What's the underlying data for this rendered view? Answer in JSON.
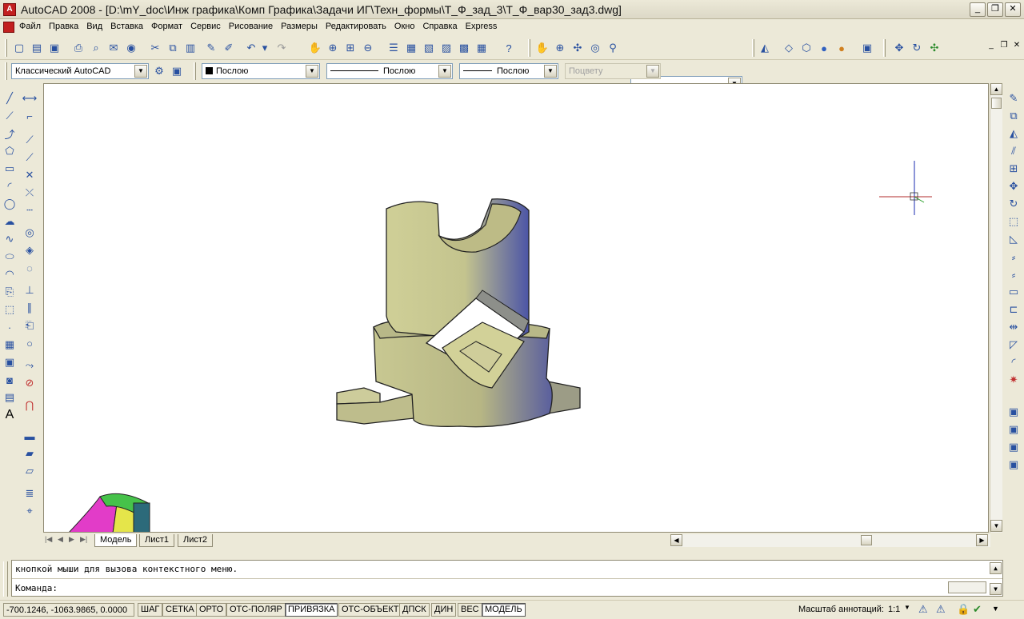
{
  "window": {
    "title": "AutoCAD 2008 - [D:\\mY_doc\\Инж графика\\Комп Графика\\Задачи ИГ\\Техн_формы\\Т_Ф_зад_3\\Т_Ф_вар30_зад3.dwg]",
    "minimize": "_",
    "restore": "❐",
    "close": "✕"
  },
  "menu": {
    "items": [
      "Файл",
      "Правка",
      "Вид",
      "Вставка",
      "Формат",
      "Сервис",
      "Рисование",
      "Размеры",
      "Редактировать",
      "Окно",
      "Справка",
      "Express"
    ]
  },
  "toolbar1": {
    "view_combo_value": ""
  },
  "toolbar2": {
    "workspace": "Классический AutoCAD",
    "layer": "Послою",
    "linetype": "Послою",
    "lineweight": "Послою",
    "plotstyle": "Поцвету"
  },
  "layout_tabs": {
    "tabs": [
      "Модель",
      "Лист1",
      "Лист2"
    ],
    "active": "Модель"
  },
  "command": {
    "history": "кнопкой мыши для вызова контекстного меню.",
    "prompt": "Команда:"
  },
  "status": {
    "coords": "-700.1246, -1063.9865, 0.0000",
    "buttons": [
      "ШАГ",
      "СЕТКА",
      "ОРТО",
      "ОТС-ПОЛЯР",
      "ПРИВЯЗКА",
      "ОТС-ОБЪЕКТ",
      "ДПСК",
      "ДИН",
      "ВЕС",
      "МОДЕЛЬ"
    ],
    "active_buttons": [
      "ПРИВЯЗКА",
      "МОДЕЛЬ"
    ],
    "annotation_label": "Масштаб аннотаций:",
    "annotation_scale": "1:1"
  },
  "colors": {
    "model_face": "#c9c98f",
    "model_shade": "#5a5f9e",
    "canvas": "#ffffff"
  }
}
